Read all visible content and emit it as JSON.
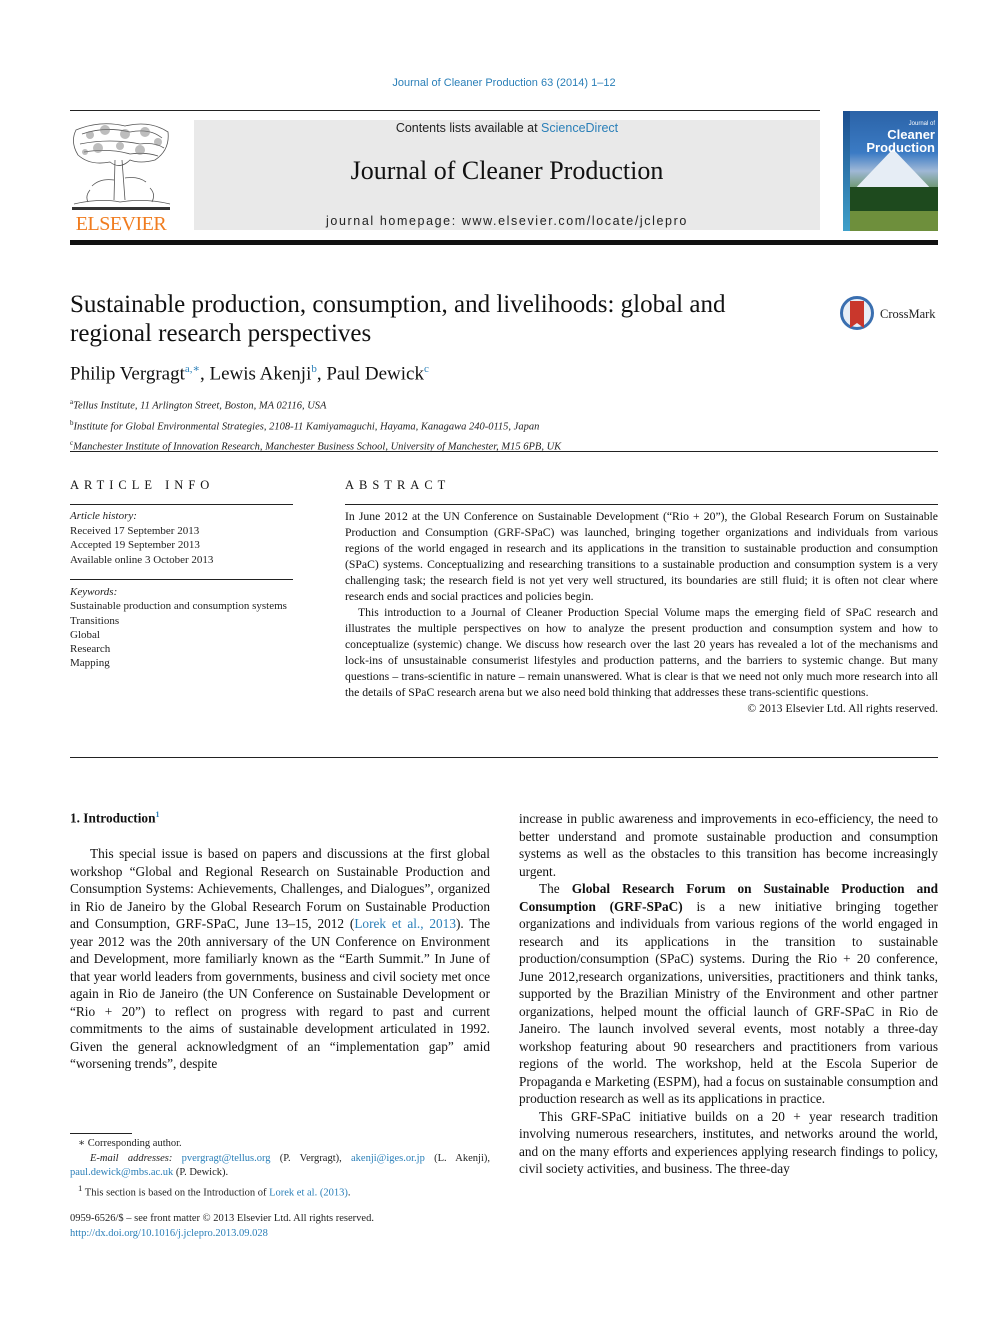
{
  "header": {
    "citation": "Journal of Cleaner Production 63 (2014) 1–12",
    "contents_prefix": "Contents lists available at ",
    "contents_link": "ScienceDirect",
    "journal_name": "Journal of Cleaner Production",
    "homepage": "journal homepage: www.elsevier.com/locate/jclepro",
    "publisher_logo_text": "ELSEVIER",
    "cover": {
      "small": "Journal of",
      "line1": "Cleaner",
      "line2": "Production"
    },
    "colors": {
      "link": "#2a7fb8",
      "elsevier_orange": "#f07c1f",
      "masthead_bg": "#e9e9e9"
    }
  },
  "article": {
    "title": "Sustainable production, consumption, and livelihoods: global and regional research perspectives",
    "crossmark_label": "CrossMark",
    "authors": [
      {
        "name": "Philip Vergragt",
        "sup": "a,∗",
        "sep": ", "
      },
      {
        "name": "Lewis Akenji",
        "sup": "b",
        "sep": ", "
      },
      {
        "name": "Paul Dewick",
        "sup": "c",
        "sep": ""
      }
    ],
    "affiliations": [
      {
        "sup": "a",
        "text": "Tellus Institute, 11 Arlington Street, Boston, MA 02116, USA"
      },
      {
        "sup": "b",
        "text": "Institute for Global Environmental Strategies, 2108-11 Kamiyamaguchi, Hayama, Kanagawa 240-0115, Japan"
      },
      {
        "sup": "c",
        "text": "Manchester Institute of Innovation Research, Manchester Business School, University of Manchester, M15 6PB, UK"
      }
    ]
  },
  "article_info": {
    "heading": "ARTICLE INFO",
    "history_label": "Article history:",
    "history": [
      "Received 17 September 2013",
      "Accepted 19 September 2013",
      "Available online 3 October 2013"
    ],
    "keywords_label": "Keywords:",
    "keywords": [
      "Sustainable production and consumption systems",
      "Transitions",
      "Global",
      "Research",
      "Mapping"
    ]
  },
  "abstract": {
    "heading": "ABSTRACT",
    "paragraphs": [
      "In June 2012 at the UN Conference on Sustainable Development (“Rio + 20”), the Global Research Forum on Sustainable Production and Consumption (GRF-SPaC) was launched, bringing together organizations and individuals from various regions of the world engaged in research and its applications in the transition to sustainable production and consumption (SPaC) systems. Conceptualizing and researching transitions to a sustainable production and consumption system is a very challenging task; the research field is not yet very well structured, its boundaries are still fluid; it is often not clear where research ends and social practices and policies begin.",
      "This introduction to a Journal of Cleaner Production Special Volume maps the emerging field of SPaC research and illustrates the multiple perspectives on how to analyze the present production and consumption system and how to conceptualize (systemic) change. We discuss how research over the last 20 years has revealed a lot of the mechanisms and lock-ins of unsustainable consumerist lifestyles and production patterns, and the barriers to systemic change. But many questions – trans-scientific in nature – remain unanswered. What is clear is that we need not only much more research into all the details of SPaC research arena but we also need bold thinking that addresses these trans-scientific questions."
    ],
    "copyright": "© 2013 Elsevier Ltd. All rights reserved."
  },
  "body": {
    "intro_heading": "1.  Introduction",
    "intro_sup": "1",
    "left_p1_a": "This special issue is based on papers and discussions at the first global workshop “Global and Regional Research on Sustainable Production and Consumption Systems: Achievements, Challenges, and Dialogues”, organized in Rio de Janeiro by the Global Research Forum on Sustainable Production and Consumption, GRF-SPaC, June 13–15, 2012 (",
    "left_p1_link": "Lorek et al., 2013",
    "left_p1_b": "). The year 2012 was the 20th anniversary of the UN Conference on Environment and Development, more familiarly known as the “Earth Summit.” In June of that year world leaders from governments, business and civil society met once again in Rio de Janeiro (the UN Conference on Sustainable Development or “Rio + 20”) to reflect on progress with regard to past and current commitments to the aims of sustainable development articulated in 1992. Given the general acknowledgment of an “implementation gap” amid “worsening trends”, despite",
    "right_p1": "increase in public awareness and improvements in eco-efficiency, the need to better understand and promote sustainable production and consumption systems as well as the obstacles to this transition has become increasingly urgent.",
    "right_p2_a": "The ",
    "right_p2_bold": "Global Research Forum on Sustainable Production and Consumption (GRF-SPaC)",
    "right_p2_b": " is a new initiative bringing together organizations and individuals from various regions of the world engaged in research and its applications in the transition to sustainable production/consumption (SPaC) systems. During the Rio + 20 conference, June 2012,research organizations, universities, practitioners and think tanks, supported by the Brazilian Ministry of the Environment and other partner organizations, helped mount the official launch of GRF-SPaC in Rio de Janeiro. The launch involved several events, most notably a three-day workshop featuring about 90 researchers and practitioners from various regions of the world. The workshop, held at the Escola Superior de Propaganda e Marketing (ESPM), had a focus on sustainable consumption and production research as well as its applications in practice.",
    "right_p3": "This GRF-SPaC initiative builds on a 20 + year research tradition involving numerous researchers, institutes, and networks around the world, and on the many efforts and experiences applying research findings to policy, civil society activities, and business. The three-day"
  },
  "footnotes": {
    "corresponding": "∗ Corresponding author.",
    "email_label": "E-mail addresses:",
    "email1": "pvergragt@tellus.org",
    "email1_who": " (P. Vergragt), ",
    "email2": "akenji@iges.or.jp",
    "email2_who": " (L. Akenji), ",
    "email3": "paul.dewick@mbs.ac.uk",
    "email3_who": " (P. Dewick).",
    "fn1_num": "1",
    "fn1_text": " This section is based on the Introduction of ",
    "fn1_link": "Lorek et al. (2013)",
    "fn1_end": "."
  },
  "front_matter": {
    "issn_line": "0959-6526/$ – see front matter © 2013 Elsevier Ltd. All rights reserved.",
    "doi": "http://dx.doi.org/10.1016/j.jclepro.2013.09.028"
  }
}
